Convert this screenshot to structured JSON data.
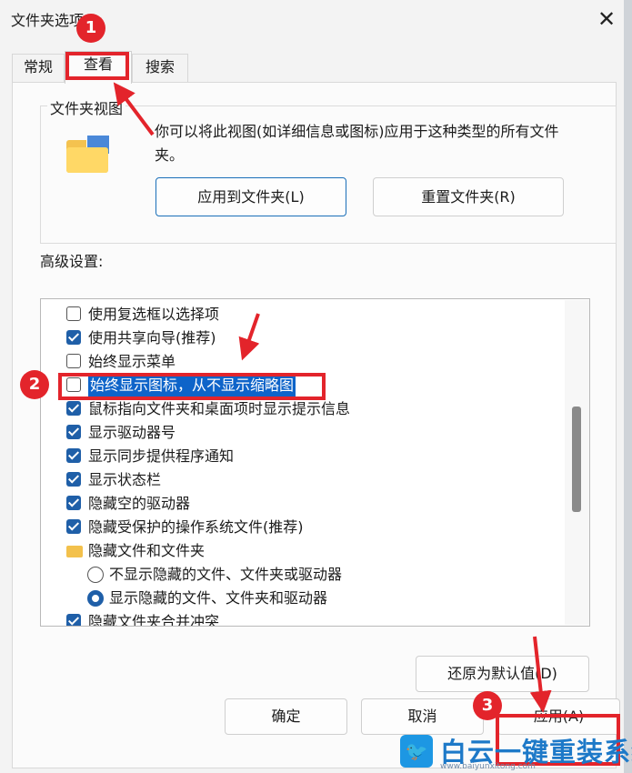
{
  "window": {
    "title": "文件夹选项",
    "close_glyph": "✕"
  },
  "tabs": [
    {
      "label": "常规"
    },
    {
      "label": "查看"
    },
    {
      "label": "搜索"
    }
  ],
  "folder_view": {
    "group_label": "文件夹视图",
    "description": "你可以将此视图(如详细信息或图标)应用于这种类型的所有文件夹。",
    "apply_button": "应用到文件夹(L)",
    "reset_button": "重置文件夹(R)"
  },
  "advanced": {
    "label": "高级设置:",
    "items": [
      {
        "label": "使用复选框以选择项",
        "checked": false
      },
      {
        "label": "使用共享向导(推荐)",
        "checked": true
      },
      {
        "label": "始终显示菜单",
        "checked": false
      },
      {
        "label": "始终显示图标，从不显示缩略图",
        "checked": false,
        "selected": true
      },
      {
        "label": "鼠标指向文件夹和桌面项时显示提示信息",
        "checked": true
      },
      {
        "label": "显示驱动器号",
        "checked": true
      },
      {
        "label": "显示同步提供程序通知",
        "checked": true
      },
      {
        "label": "显示状态栏",
        "checked": true
      },
      {
        "label": "隐藏空的驱动器",
        "checked": true
      },
      {
        "label": "隐藏受保护的操作系统文件(推荐)",
        "checked": true
      },
      {
        "label": "隐藏文件和文件夹",
        "type": "folder"
      },
      {
        "label": "不显示隐藏的文件、文件夹或驱动器",
        "type": "radio",
        "checked": false
      },
      {
        "label": "显示隐藏的文件、文件夹和驱动器",
        "type": "radio",
        "checked": true
      },
      {
        "label": "隐藏文件夹合并冲突",
        "checked": true
      }
    ]
  },
  "buttons": {
    "restore_defaults": "还原为默认值(D)",
    "ok": "确定",
    "cancel": "取消",
    "apply": "应用(A)"
  },
  "annotations": {
    "badges": [
      "1",
      "2",
      "3"
    ],
    "color": "#e3242b"
  },
  "watermark": {
    "text": "白云一键重装系统",
    "url": "www.baiyunxitong.com"
  },
  "colors": {
    "accent": "#1f5fa8",
    "selection": "#0e64c9"
  }
}
